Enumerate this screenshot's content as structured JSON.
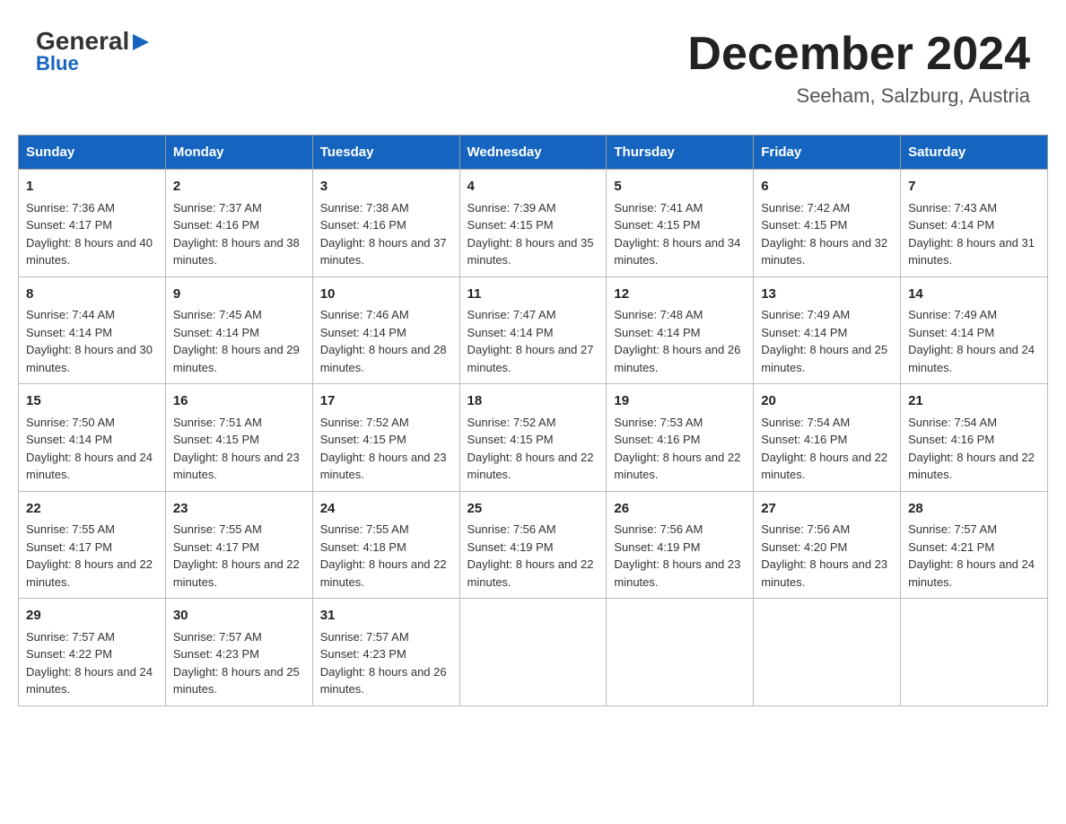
{
  "header": {
    "logo": {
      "general": "General",
      "arrow": "▶",
      "blue": "Blue"
    },
    "title": "December 2024",
    "location": "Seeham, Salzburg, Austria"
  },
  "calendar": {
    "days_of_week": [
      "Sunday",
      "Monday",
      "Tuesday",
      "Wednesday",
      "Thursday",
      "Friday",
      "Saturday"
    ],
    "weeks": [
      [
        {
          "day": "1",
          "sunrise": "Sunrise: 7:36 AM",
          "sunset": "Sunset: 4:17 PM",
          "daylight": "Daylight: 8 hours and 40 minutes."
        },
        {
          "day": "2",
          "sunrise": "Sunrise: 7:37 AM",
          "sunset": "Sunset: 4:16 PM",
          "daylight": "Daylight: 8 hours and 38 minutes."
        },
        {
          "day": "3",
          "sunrise": "Sunrise: 7:38 AM",
          "sunset": "Sunset: 4:16 PM",
          "daylight": "Daylight: 8 hours and 37 minutes."
        },
        {
          "day": "4",
          "sunrise": "Sunrise: 7:39 AM",
          "sunset": "Sunset: 4:15 PM",
          "daylight": "Daylight: 8 hours and 35 minutes."
        },
        {
          "day": "5",
          "sunrise": "Sunrise: 7:41 AM",
          "sunset": "Sunset: 4:15 PM",
          "daylight": "Daylight: 8 hours and 34 minutes."
        },
        {
          "day": "6",
          "sunrise": "Sunrise: 7:42 AM",
          "sunset": "Sunset: 4:15 PM",
          "daylight": "Daylight: 8 hours and 32 minutes."
        },
        {
          "day": "7",
          "sunrise": "Sunrise: 7:43 AM",
          "sunset": "Sunset: 4:14 PM",
          "daylight": "Daylight: 8 hours and 31 minutes."
        }
      ],
      [
        {
          "day": "8",
          "sunrise": "Sunrise: 7:44 AM",
          "sunset": "Sunset: 4:14 PM",
          "daylight": "Daylight: 8 hours and 30 minutes."
        },
        {
          "day": "9",
          "sunrise": "Sunrise: 7:45 AM",
          "sunset": "Sunset: 4:14 PM",
          "daylight": "Daylight: 8 hours and 29 minutes."
        },
        {
          "day": "10",
          "sunrise": "Sunrise: 7:46 AM",
          "sunset": "Sunset: 4:14 PM",
          "daylight": "Daylight: 8 hours and 28 minutes."
        },
        {
          "day": "11",
          "sunrise": "Sunrise: 7:47 AM",
          "sunset": "Sunset: 4:14 PM",
          "daylight": "Daylight: 8 hours and 27 minutes."
        },
        {
          "day": "12",
          "sunrise": "Sunrise: 7:48 AM",
          "sunset": "Sunset: 4:14 PM",
          "daylight": "Daylight: 8 hours and 26 minutes."
        },
        {
          "day": "13",
          "sunrise": "Sunrise: 7:49 AM",
          "sunset": "Sunset: 4:14 PM",
          "daylight": "Daylight: 8 hours and 25 minutes."
        },
        {
          "day": "14",
          "sunrise": "Sunrise: 7:49 AM",
          "sunset": "Sunset: 4:14 PM",
          "daylight": "Daylight: 8 hours and 24 minutes."
        }
      ],
      [
        {
          "day": "15",
          "sunrise": "Sunrise: 7:50 AM",
          "sunset": "Sunset: 4:14 PM",
          "daylight": "Daylight: 8 hours and 24 minutes."
        },
        {
          "day": "16",
          "sunrise": "Sunrise: 7:51 AM",
          "sunset": "Sunset: 4:15 PM",
          "daylight": "Daylight: 8 hours and 23 minutes."
        },
        {
          "day": "17",
          "sunrise": "Sunrise: 7:52 AM",
          "sunset": "Sunset: 4:15 PM",
          "daylight": "Daylight: 8 hours and 23 minutes."
        },
        {
          "day": "18",
          "sunrise": "Sunrise: 7:52 AM",
          "sunset": "Sunset: 4:15 PM",
          "daylight": "Daylight: 8 hours and 22 minutes."
        },
        {
          "day": "19",
          "sunrise": "Sunrise: 7:53 AM",
          "sunset": "Sunset: 4:16 PM",
          "daylight": "Daylight: 8 hours and 22 minutes."
        },
        {
          "day": "20",
          "sunrise": "Sunrise: 7:54 AM",
          "sunset": "Sunset: 4:16 PM",
          "daylight": "Daylight: 8 hours and 22 minutes."
        },
        {
          "day": "21",
          "sunrise": "Sunrise: 7:54 AM",
          "sunset": "Sunset: 4:16 PM",
          "daylight": "Daylight: 8 hours and 22 minutes."
        }
      ],
      [
        {
          "day": "22",
          "sunrise": "Sunrise: 7:55 AM",
          "sunset": "Sunset: 4:17 PM",
          "daylight": "Daylight: 8 hours and 22 minutes."
        },
        {
          "day": "23",
          "sunrise": "Sunrise: 7:55 AM",
          "sunset": "Sunset: 4:17 PM",
          "daylight": "Daylight: 8 hours and 22 minutes."
        },
        {
          "day": "24",
          "sunrise": "Sunrise: 7:55 AM",
          "sunset": "Sunset: 4:18 PM",
          "daylight": "Daylight: 8 hours and 22 minutes."
        },
        {
          "day": "25",
          "sunrise": "Sunrise: 7:56 AM",
          "sunset": "Sunset: 4:19 PM",
          "daylight": "Daylight: 8 hours and 22 minutes."
        },
        {
          "day": "26",
          "sunrise": "Sunrise: 7:56 AM",
          "sunset": "Sunset: 4:19 PM",
          "daylight": "Daylight: 8 hours and 23 minutes."
        },
        {
          "day": "27",
          "sunrise": "Sunrise: 7:56 AM",
          "sunset": "Sunset: 4:20 PM",
          "daylight": "Daylight: 8 hours and 23 minutes."
        },
        {
          "day": "28",
          "sunrise": "Sunrise: 7:57 AM",
          "sunset": "Sunset: 4:21 PM",
          "daylight": "Daylight: 8 hours and 24 minutes."
        }
      ],
      [
        {
          "day": "29",
          "sunrise": "Sunrise: 7:57 AM",
          "sunset": "Sunset: 4:22 PM",
          "daylight": "Daylight: 8 hours and 24 minutes."
        },
        {
          "day": "30",
          "sunrise": "Sunrise: 7:57 AM",
          "sunset": "Sunset: 4:23 PM",
          "daylight": "Daylight: 8 hours and 25 minutes."
        },
        {
          "day": "31",
          "sunrise": "Sunrise: 7:57 AM",
          "sunset": "Sunset: 4:23 PM",
          "daylight": "Daylight: 8 hours and 26 minutes."
        },
        null,
        null,
        null,
        null
      ]
    ]
  }
}
